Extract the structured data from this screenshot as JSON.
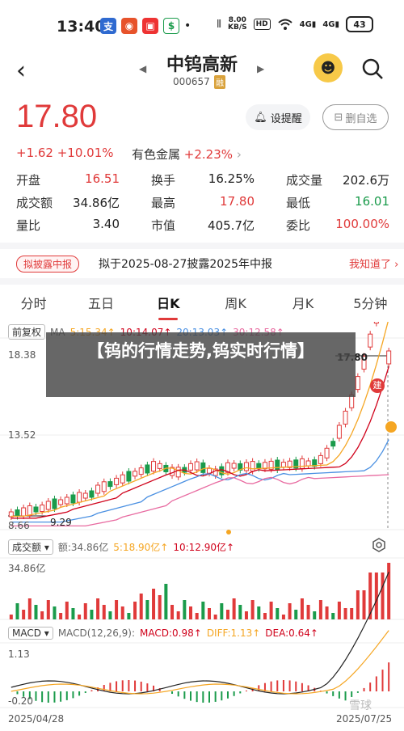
{
  "status": {
    "time": "13:40",
    "net_speed_value": "8.00",
    "net_speed_unit": "KB/S",
    "hd": "HD",
    "signal_4g": "4G",
    "battery": "43"
  },
  "nav": {
    "name": "中钨高新",
    "code": "000657",
    "tag": "融"
  },
  "quote": {
    "price": "17.80",
    "change": "+1.62 +10.01%",
    "sector_name": "有色金属",
    "sector_change": "+2.23%",
    "alert_label": "设提醒",
    "remove_label": "删自选"
  },
  "stats": [
    [
      {
        "label": "开盘",
        "value": "16.51",
        "color": "red"
      },
      {
        "label": "换手",
        "value": "16.25%",
        "color": "plain"
      },
      {
        "label": "成交量",
        "value": "202.6万",
        "color": "plain"
      }
    ],
    [
      {
        "label": "成交额",
        "value": "34.86亿",
        "color": "plain"
      },
      {
        "label": "最高",
        "value": "17.80",
        "color": "red"
      },
      {
        "label": "最低",
        "value": "16.01",
        "color": "green"
      }
    ],
    [
      {
        "label": "量比",
        "value": "3.40",
        "color": "plain"
      },
      {
        "label": "市值",
        "value": "405.7亿",
        "color": "plain"
      },
      {
        "label": "委比",
        "value": "100.00%",
        "color": "red"
      }
    ]
  ],
  "notice": {
    "badge": "拟披露中报",
    "text": "拟于2025-08-27披露2025年中报",
    "action": "我知道了"
  },
  "tabs": [
    "分时",
    "五日",
    "日K",
    "周K",
    "月K",
    "5分钟"
  ],
  "kline_legend": {
    "adjust": "前复权",
    "ma_label": "MA",
    "ma5": "5:15.34↑",
    "ma10": "10:14.07↑",
    "ma20": "20:13.03↑",
    "ma30": "30:12.58↑"
  },
  "kline_axis": {
    "high": "18.38",
    "mid": "13.52",
    "low": "8.66",
    "min_mark": "9.29",
    "current": "17.80",
    "jian": "建"
  },
  "volume_legend": {
    "label": "成交额",
    "amount": "额:34.86亿",
    "v5": "5:18.90亿↑",
    "v10": "10:12.90亿↑",
    "max": "34.86亿"
  },
  "macd_legend": {
    "label": "MACD",
    "params": "MACD(12,26,9):",
    "macd": "MACD:0.98↑",
    "diff": "DIFF:1.13↑",
    "dea": "DEA:0.64↑",
    "max": "1.13",
    "min": "-0.20"
  },
  "footer": {
    "date_left": "2025/04/28",
    "date_right": "2025/07/25"
  },
  "banner": {
    "title": "【钨的行情走势,钨实时行情】"
  },
  "watermark": "雪球",
  "colors": {
    "up": "#e03a3a",
    "down": "#1a9b4b",
    "ma5": "#f5a623",
    "ma10": "#d0021b",
    "ma20": "#4a90e2",
    "ma30": "#e86aa0"
  }
}
